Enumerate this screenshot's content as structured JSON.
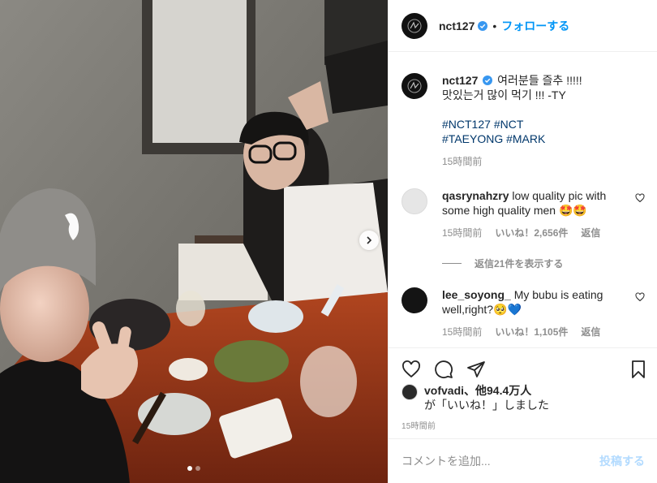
{
  "post": {
    "username": "nct127",
    "separator": "•",
    "follow_label": "フォローする",
    "carousel": {
      "total_slides": 2,
      "active_slide": 1
    }
  },
  "caption": {
    "username": "nct127",
    "text": "여러분들 즐추 !!!!!\n맛있는거 많이 먹기 !!! -TY",
    "hashtags": [
      "#NCT127",
      "#NCT",
      "#TAEYONG",
      "#MARK"
    ],
    "time": "15時間前"
  },
  "comments": [
    {
      "username": "qasrynahzry",
      "text": "low quality pic with some high quality men 🤩🤩",
      "time": "15時間前",
      "likes": "いいね！2,656件",
      "reply_label": "返信",
      "view_replies": "返信21件を表示する"
    },
    {
      "username": "lee_soyong_",
      "text": "My bubu is eating well,right?🥺💙",
      "time": "15時間前",
      "likes": "いいね！1,105件",
      "reply_label": "返信"
    }
  ],
  "likes_summary": {
    "user": "vofvadi",
    "others": "、他94.4万人",
    "suffix": "が「いいね！」しました"
  },
  "post_time": "15時間前",
  "add_comment": {
    "placeholder": "コメントを追加...",
    "post_label": "投稿する"
  },
  "icons": {
    "like": "heart-icon",
    "comment": "comment-icon",
    "share": "paper-plane-icon",
    "save": "bookmark-icon",
    "verified": "verified-badge-icon",
    "next": "chevron-right-icon"
  },
  "colors": {
    "link_blue": "#0095f6",
    "hashtag": "#00376b",
    "muted": "#8e8e8e",
    "verified": "#3897f0",
    "post_button_disabled": "#b3dbff"
  }
}
